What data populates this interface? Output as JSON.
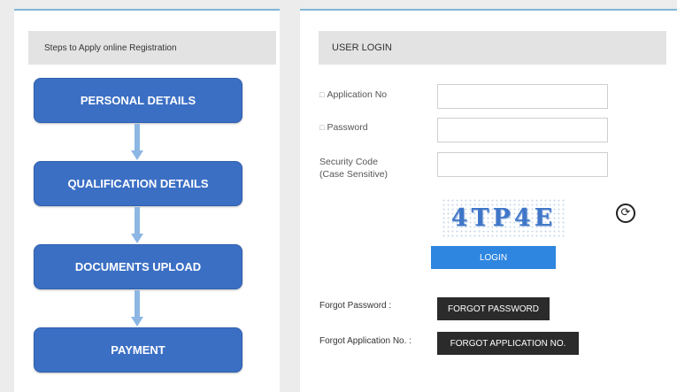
{
  "steps_panel": {
    "header": "Steps to Apply online Registration",
    "steps": [
      {
        "label": "PERSONAL DETAILS"
      },
      {
        "label": "QUALIFICATION DETAILS"
      },
      {
        "label": "DOCUMENTS UPLOAD"
      },
      {
        "label": "PAYMENT"
      }
    ]
  },
  "login_panel": {
    "header": "USER LOGIN",
    "application_no_label": "Application No",
    "password_label": "Password",
    "security_code_label_line1": "Security Code",
    "security_code_label_line2": "(Case Sensitive)",
    "application_no_value": "",
    "password_value": "",
    "security_code_value": "",
    "captcha_text": "4TP4E",
    "refresh_icon": "refresh-icon",
    "login_button": "LOGIN",
    "forgot_password_label": "Forgot Password :",
    "forgot_password_button": "FORGOT PASSWORD",
    "forgot_app_label": "Forgot Application No. :",
    "forgot_app_button": "FORGOT APPLICATION NO."
  },
  "colors": {
    "step_blue": "#3b6fc4",
    "arrow_blue": "#8cb6e3",
    "login_blue": "#2e86e0",
    "dark_button": "#2b2b2b"
  }
}
